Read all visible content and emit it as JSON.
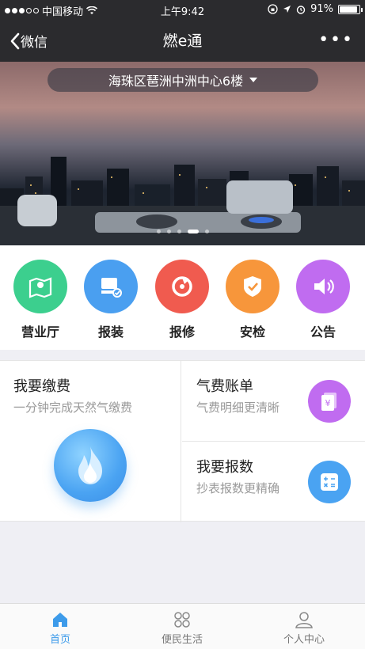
{
  "status_bar": {
    "carrier": "中国移动",
    "time": "上午9:42",
    "battery": "91%",
    "battery_level": 0.91
  },
  "nav": {
    "back_label": "微信",
    "title": "燃e通",
    "more_label": "•••"
  },
  "banner": {
    "location": "海珠区琶洲中洲中心6楼",
    "slide_count": 5,
    "active_slide": 4
  },
  "quick_actions": [
    {
      "label": "营业厅",
      "icon": "map-location-icon",
      "color": "#3ccf8e"
    },
    {
      "label": "报装",
      "icon": "truck-install-icon",
      "color": "#4a9ff0"
    },
    {
      "label": "报修",
      "icon": "repair-icon",
      "color": "#f05b4f"
    },
    {
      "label": "安检",
      "icon": "shield-check-icon",
      "color": "#f7963b"
    },
    {
      "label": "公告",
      "icon": "speaker-icon",
      "color": "#c06cf0"
    }
  ],
  "cards": {
    "pay": {
      "title": "我要缴费",
      "subtitle": "一分钟完成天然气缴费",
      "icon": "flame-icon"
    },
    "bill": {
      "title": "气费账单",
      "subtitle": "气费明细更清晰",
      "icon": "bill-icon",
      "color": "#c06cf0"
    },
    "meter": {
      "title": "我要报数",
      "subtitle": "抄表报数更精确",
      "icon": "calculator-icon",
      "color": "#4aa3f2"
    }
  },
  "tabs": [
    {
      "label": "首页",
      "icon": "home-icon",
      "active": true
    },
    {
      "label": "便民生活",
      "icon": "grid-icon",
      "active": false
    },
    {
      "label": "个人中心",
      "icon": "user-icon",
      "active": false
    }
  ],
  "colors": {
    "bar": "#2b2b2e",
    "accent": "#3d9bea"
  }
}
